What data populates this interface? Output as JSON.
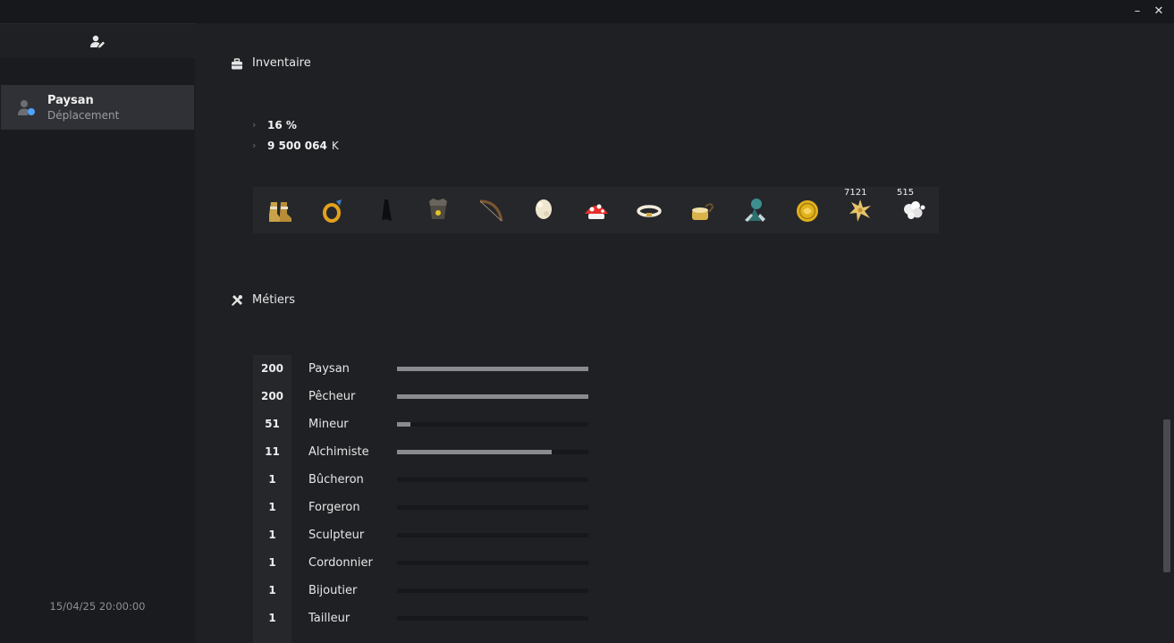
{
  "window": {
    "minimize_glyph": "–",
    "close_glyph": "✕"
  },
  "sidebar": {
    "account_icon": "user-edit-icon",
    "character": {
      "name": "Paysan",
      "subtitle": "Déplacement"
    },
    "datetime": "15/04/25 20:00:00"
  },
  "inventory": {
    "title": "Inventaire",
    "icon": "briefcase-icon",
    "stats": [
      {
        "value": "16 %",
        "unit": ""
      },
      {
        "value": "9 500 064",
        "unit": "K"
      }
    ],
    "items": [
      {
        "name": "boots-item-icon",
        "count": ""
      },
      {
        "name": "ring-item-icon",
        "count": ""
      },
      {
        "name": "cape-item-icon",
        "count": ""
      },
      {
        "name": "hat-item-icon",
        "count": ""
      },
      {
        "name": "bow-item-icon",
        "count": ""
      },
      {
        "name": "wool-item-icon",
        "count": ""
      },
      {
        "name": "mushroom-item-icon",
        "count": ""
      },
      {
        "name": "belt-item-icon",
        "count": ""
      },
      {
        "name": "bag-item-icon",
        "count": ""
      },
      {
        "name": "pet-item-icon",
        "count": ""
      },
      {
        "name": "coin-item-icon",
        "count": ""
      },
      {
        "name": "flower-item-icon",
        "count": "7121"
      },
      {
        "name": "fluff-item-icon",
        "count": "515"
      }
    ]
  },
  "jobs": {
    "title": "Métiers",
    "icon": "tools-icon",
    "rows": [
      {
        "level": "200",
        "name": "Paysan",
        "progress": 1.0
      },
      {
        "level": "200",
        "name": "Pêcheur",
        "progress": 1.0
      },
      {
        "level": "51",
        "name": "Mineur",
        "progress": 0.07
      },
      {
        "level": "11",
        "name": "Alchimiste",
        "progress": 0.81
      },
      {
        "level": "1",
        "name": "Bûcheron",
        "progress": 0
      },
      {
        "level": "1",
        "name": "Forgeron",
        "progress": 0
      },
      {
        "level": "1",
        "name": "Sculpteur",
        "progress": 0
      },
      {
        "level": "1",
        "name": "Cordonnier",
        "progress": 0
      },
      {
        "level": "1",
        "name": "Bijoutier",
        "progress": 0
      },
      {
        "level": "1",
        "name": "Tailleur",
        "progress": 0
      }
    ]
  }
}
